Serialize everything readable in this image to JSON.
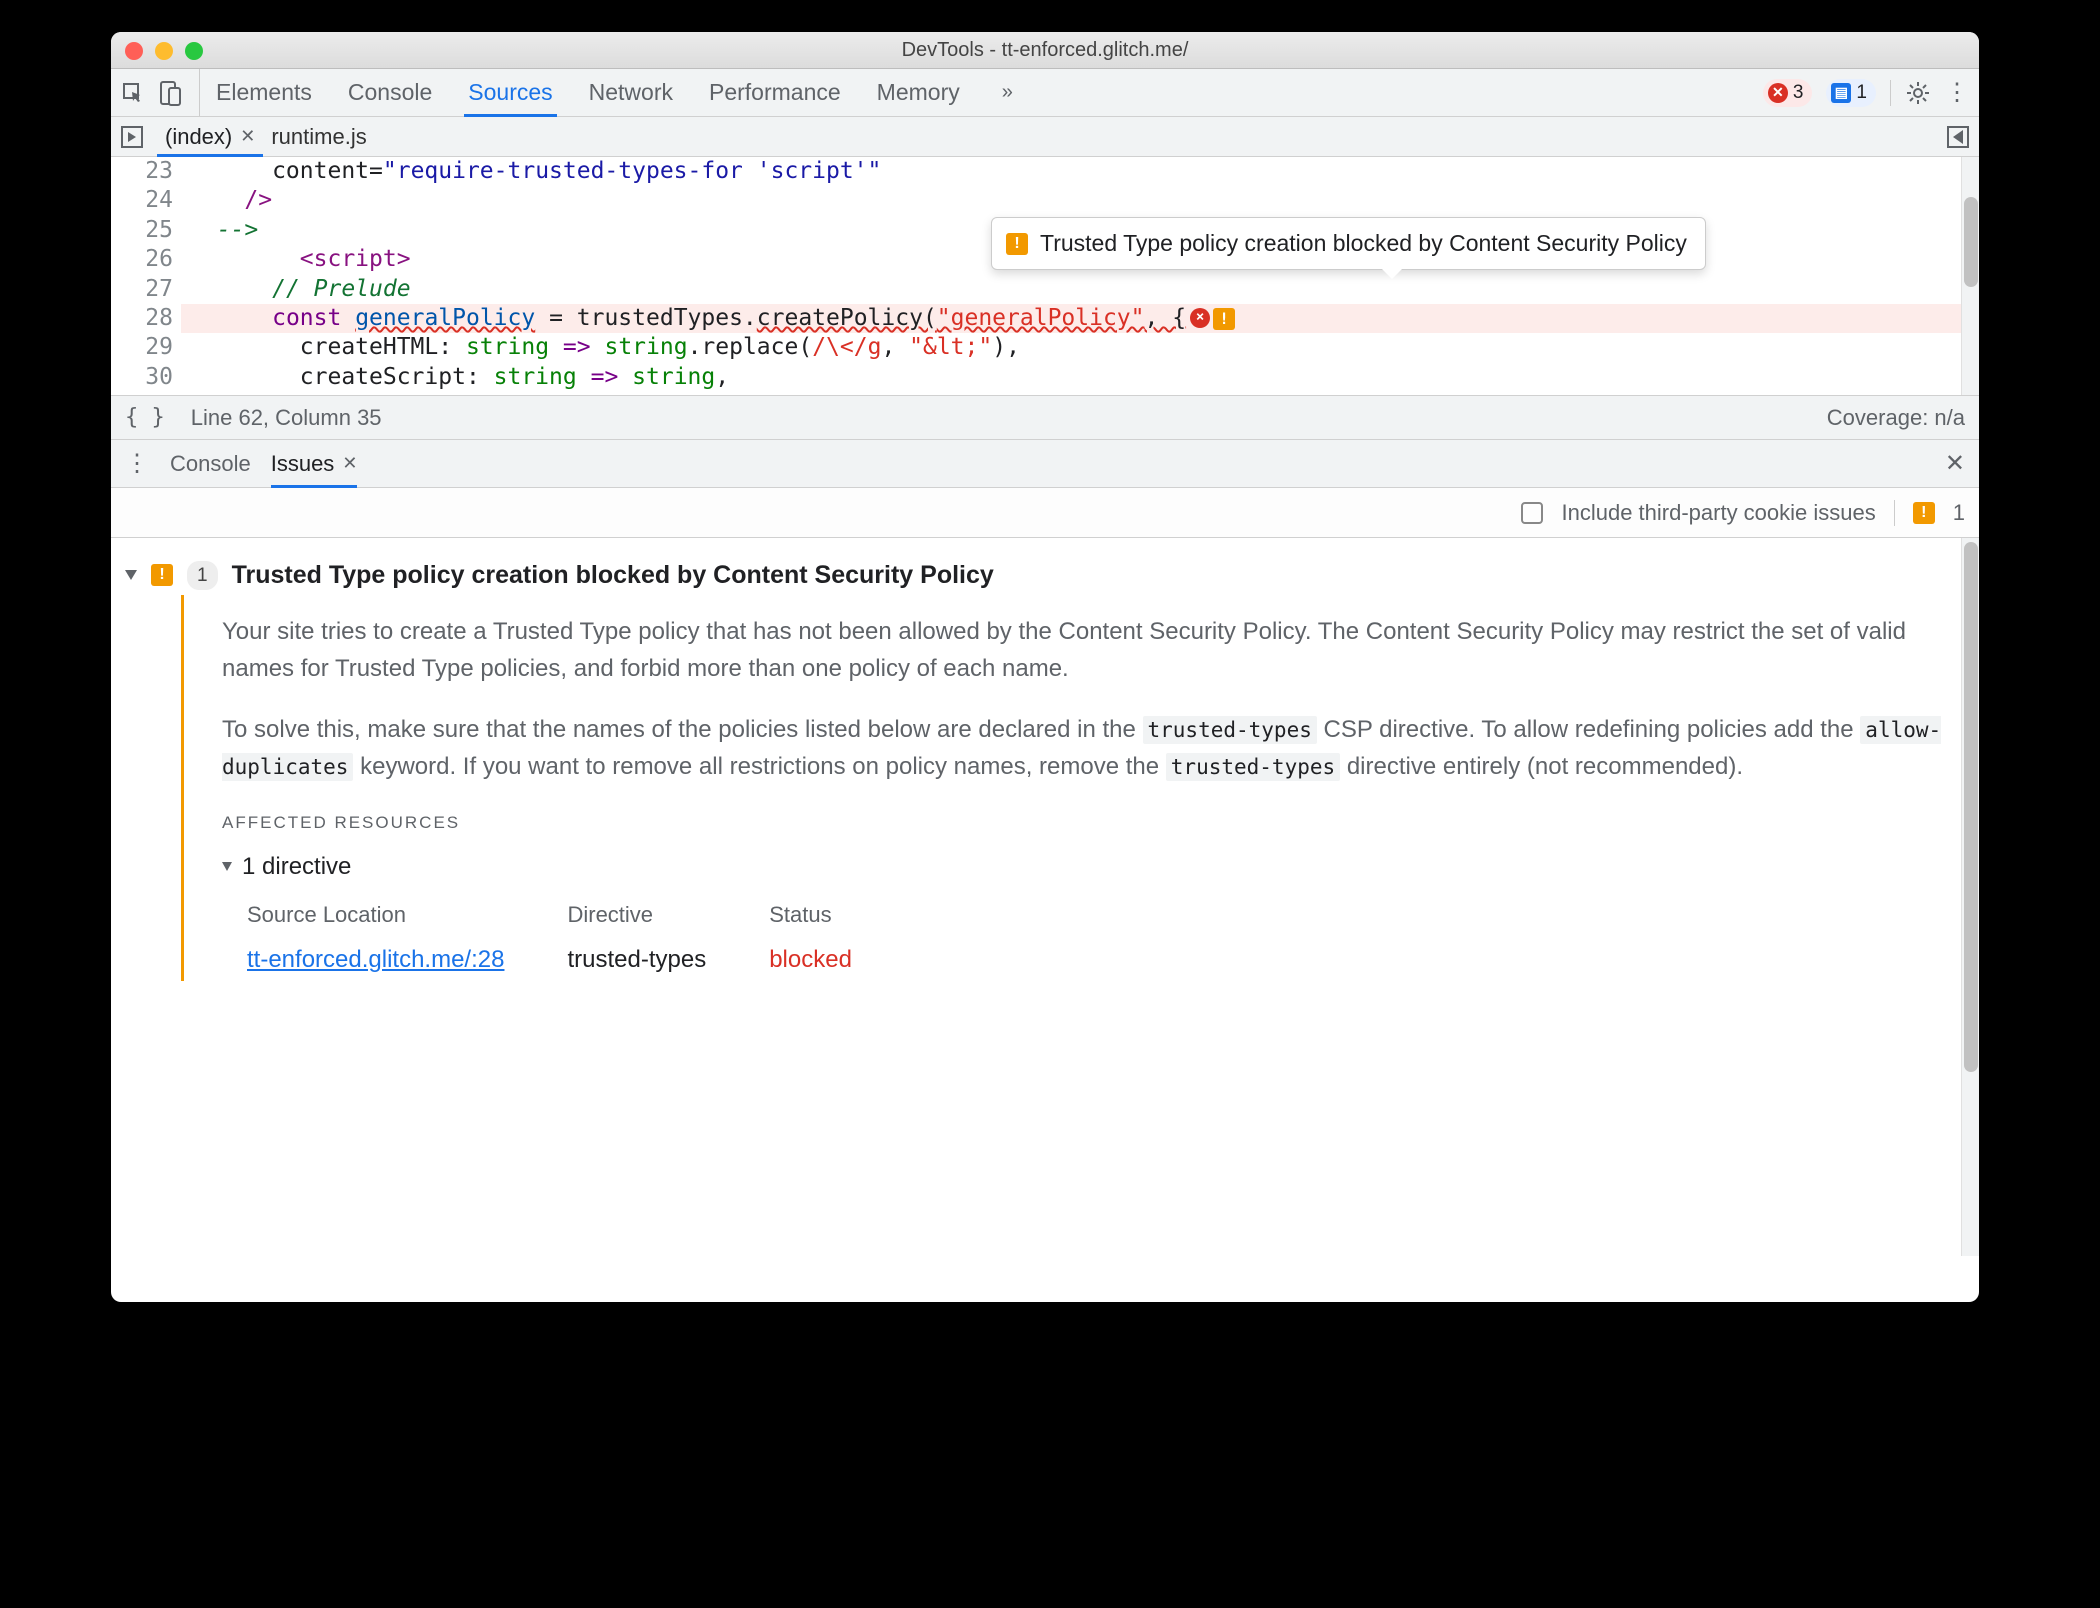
{
  "window_title": "DevTools - tt-enforced.glitch.me/",
  "toolbar": {
    "tabs": [
      "Elements",
      "Console",
      "Sources",
      "Network",
      "Performance",
      "Memory"
    ],
    "active_tab": "Sources",
    "error_count": "3",
    "message_count": "1"
  },
  "file_tabs": {
    "items": [
      "(index)",
      "runtime.js"
    ],
    "active": "(index)"
  },
  "editor": {
    "gutter_start": 23,
    "lines": [
      {
        "n": 23,
        "html": "      content=<span class='tok-str'>\"require-trusted-types-for 'script'\"</span>"
      },
      {
        "n": 24,
        "html": "    <span class='tok-tag'>/&gt;</span>"
      },
      {
        "n": 25,
        "html": "  <span class='tok-comment'>--&gt;</span>"
      },
      {
        "n": 26,
        "html": "        <span class='tok-tag'>&lt;script&gt;</span>"
      },
      {
        "n": 27,
        "html": "      <span class='tok-comment'>// Prelude</span>"
      },
      {
        "n": 28,
        "hl": true,
        "html": "      <span class='tok-kw'>const</span> <span class='tok-var wavy'>generalPolicy</span> = trustedTypes.<span class='wavy'>createPolicy(</span><span class='tok-red wavy'>\"generalPolicy\"</span><span class='wavy'>, {</span><span class='inline-err-icons'><span class='circ-x'>×</span><span class='warn-ico'>!</span></span>"
      },
      {
        "n": 29,
        "html": "        createHTML: <span class='tok-type'>string</span> <span class='tok-kw'>=&gt;</span> <span class='tok-type'>string</span>.replace(<span class='tok-red'>/\\&lt;/g</span>, <span class='tok-red'>\"&amp;lt;\"</span>),"
      },
      {
        "n": 30,
        "html": "        createScript: <span class='tok-type'>string</span> <span class='tok-kw'>=&gt;</span> <span class='tok-type'>string</span>,"
      }
    ],
    "tooltip": "Trusted Type policy creation blocked by Content Security Policy"
  },
  "statusbar": {
    "position": "Line 62, Column 35",
    "coverage": "Coverage: n/a"
  },
  "drawer": {
    "tabs": [
      "Console",
      "Issues"
    ],
    "active": "Issues",
    "include_third_party_label": "Include third-party cookie issues",
    "issue_count_right": "1"
  },
  "issue": {
    "badge_count": "1",
    "title": "Trusted Type policy creation blocked by Content Security Policy",
    "para1": "Your site tries to create a Trusted Type policy that has not been allowed by the Content Security Policy. The Content Security Policy may restrict the set of valid names for Trusted Type policies, and forbid more than one policy of each name.",
    "para2_a": "To solve this, make sure that the names of the policies listed below are declared in the ",
    "code1": "trusted-types",
    "para2_b": " CSP directive. To allow redefining policies add the ",
    "code2": "allow-duplicates",
    "para2_c": " keyword. If you want to remove all restrictions on policy names, remove the ",
    "code3": "trusted-types",
    "para2_d": " directive entirely (not recommended).",
    "section": "AFFECTED RESOURCES",
    "directive_summary": "1 directive",
    "table": {
      "headers": [
        "Source Location",
        "Directive",
        "Status"
      ],
      "row": {
        "source": "tt-enforced.glitch.me/:28",
        "directive": "trusted-types",
        "status": "blocked"
      }
    }
  }
}
